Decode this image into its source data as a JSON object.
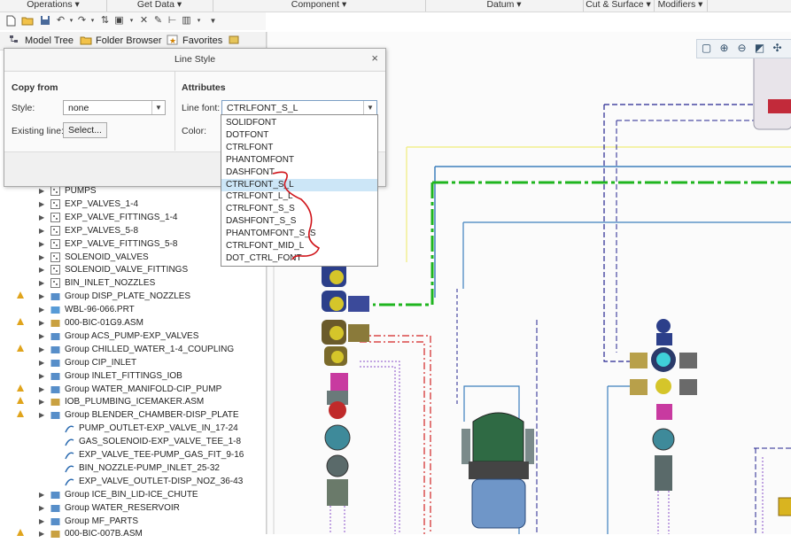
{
  "ribbon": {
    "groups": [
      "Operations ▾",
      "Get Data ▾",
      "Component ▾",
      "Datum ▾",
      "Cut & Surface ▾",
      "Modifiers ▾"
    ]
  },
  "navigator": {
    "tabs": [
      {
        "label": "Model Tree"
      },
      {
        "label": "Folder Browser"
      },
      {
        "label": "Favorites"
      }
    ]
  },
  "dialog": {
    "title": "Line Style",
    "close_glyph": "×",
    "copy_from_heading": "Copy from",
    "style_label": "Style:",
    "style_value": "none",
    "existing_line_label": "Existing line:",
    "select_button": "Select...",
    "attributes_heading": "Attributes",
    "line_font_label": "Line font:",
    "line_font_value": "CTRLFONT_S_L",
    "color_label": "Color:"
  },
  "line_font_options": [
    "SOLIDFONT",
    "DOTFONT",
    "CTRLFONT",
    "PHANTOMFONT",
    "DASHFONT",
    "CTRLFONT_S_L",
    "CTRLFONT_L_L",
    "CTRLFONT_S_S",
    "DASHFONT_S_S",
    "PHANTOMFONT_S_S",
    "CTRLFONT_MID_L",
    "DOT_CTRL_FONT"
  ],
  "selected_option": "CTRLFONT_S_L",
  "tree_rows": [
    {
      "label": "PUMPS",
      "icon": "assembly-icon",
      "warn": false,
      "indent": 1
    },
    {
      "label": "EXP_VALVES_1-4",
      "icon": "assembly-icon",
      "warn": false,
      "indent": 1
    },
    {
      "label": "EXP_VALVE_FITTINGS_1-4",
      "icon": "assembly-icon",
      "warn": false,
      "indent": 1
    },
    {
      "label": "EXP_VALVES_5-8",
      "icon": "assembly-icon",
      "warn": false,
      "indent": 1
    },
    {
      "label": "EXP_VALVE_FITTINGS_5-8",
      "icon": "assembly-icon",
      "warn": false,
      "indent": 1
    },
    {
      "label": "SOLENOID_VALVES",
      "icon": "assembly-icon",
      "warn": false,
      "indent": 1
    },
    {
      "label": "SOLENOID_VALVE_FITTINGS",
      "icon": "assembly-icon",
      "warn": false,
      "indent": 1
    },
    {
      "label": "BIN_INLET_NOZZLES",
      "icon": "assembly-icon",
      "warn": false,
      "indent": 1
    },
    {
      "label": "Group DISP_PLATE_NOZZLES",
      "icon": "group-icon",
      "warn": true,
      "indent": 1
    },
    {
      "label": "WBL-96-066.PRT",
      "icon": "part-icon",
      "warn": false,
      "indent": 1
    },
    {
      "label": "000-BIC-01G9.ASM",
      "icon": "asm-file-icon",
      "warn": true,
      "indent": 1
    },
    {
      "label": "Group ACS_PUMP-EXP_VALVES",
      "icon": "group-icon",
      "warn": false,
      "indent": 1
    },
    {
      "label": "Group CHILLED_WATER_1-4_COUPLING",
      "icon": "group-icon",
      "warn": true,
      "indent": 1
    },
    {
      "label": "Group CIP_INLET",
      "icon": "group-icon",
      "warn": false,
      "indent": 1
    },
    {
      "label": "Group INLET_FITTINGS_IOB",
      "icon": "group-icon",
      "warn": false,
      "indent": 1
    },
    {
      "label": "Group WATER_MANIFOLD-CIP_PUMP",
      "icon": "group-icon",
      "warn": true,
      "indent": 1
    },
    {
      "label": "IOB_PLUMBING_ICEMAKER.ASM",
      "icon": "asm-file-icon",
      "warn": true,
      "indent": 1
    },
    {
      "label": "Group BLENDER_CHAMBER-DISP_PLATE",
      "icon": "group-icon",
      "warn": true,
      "indent": 1
    },
    {
      "label": "PUMP_OUTLET-EXP_VALVE_IN_17-24",
      "icon": "pipe-icon",
      "warn": false,
      "indent": 2
    },
    {
      "label": "GAS_SOLENOID-EXP_VALVE_TEE_1-8",
      "icon": "pipe-icon",
      "warn": false,
      "indent": 2
    },
    {
      "label": "EXP_VALVE_TEE-PUMP_GAS_FIT_9-16",
      "icon": "pipe-icon",
      "warn": false,
      "indent": 2
    },
    {
      "label": "BIN_NOZZLE-PUMP_INLET_25-32",
      "icon": "pipe-icon",
      "warn": false,
      "indent": 2
    },
    {
      "label": "EXP_VALVE_OUTLET-DISP_NOZ_36-43",
      "icon": "pipe-icon",
      "warn": false,
      "indent": 2
    },
    {
      "label": "Group ICE_BIN_LID-ICE_CHUTE",
      "icon": "group-icon",
      "warn": false,
      "indent": 1
    },
    {
      "label": "Group WATER_RESERVOIR",
      "icon": "group-icon",
      "warn": false,
      "indent": 1
    },
    {
      "label": "Group MF_PARTS",
      "icon": "group-icon",
      "warn": false,
      "indent": 1
    },
    {
      "label": "000-BIC-007B.ASM",
      "icon": "asm-file-icon",
      "warn": true,
      "indent": 1
    }
  ],
  "colors": {
    "selection": "#cce6f7",
    "annotation_red": "#d0141a",
    "pipe_green": "#1fb51f",
    "pipe_blue": "#3d7fbd",
    "dash_navy": "#23238f",
    "pipe_yellow": "#f0ec7a",
    "warn": "#e0a41c"
  }
}
